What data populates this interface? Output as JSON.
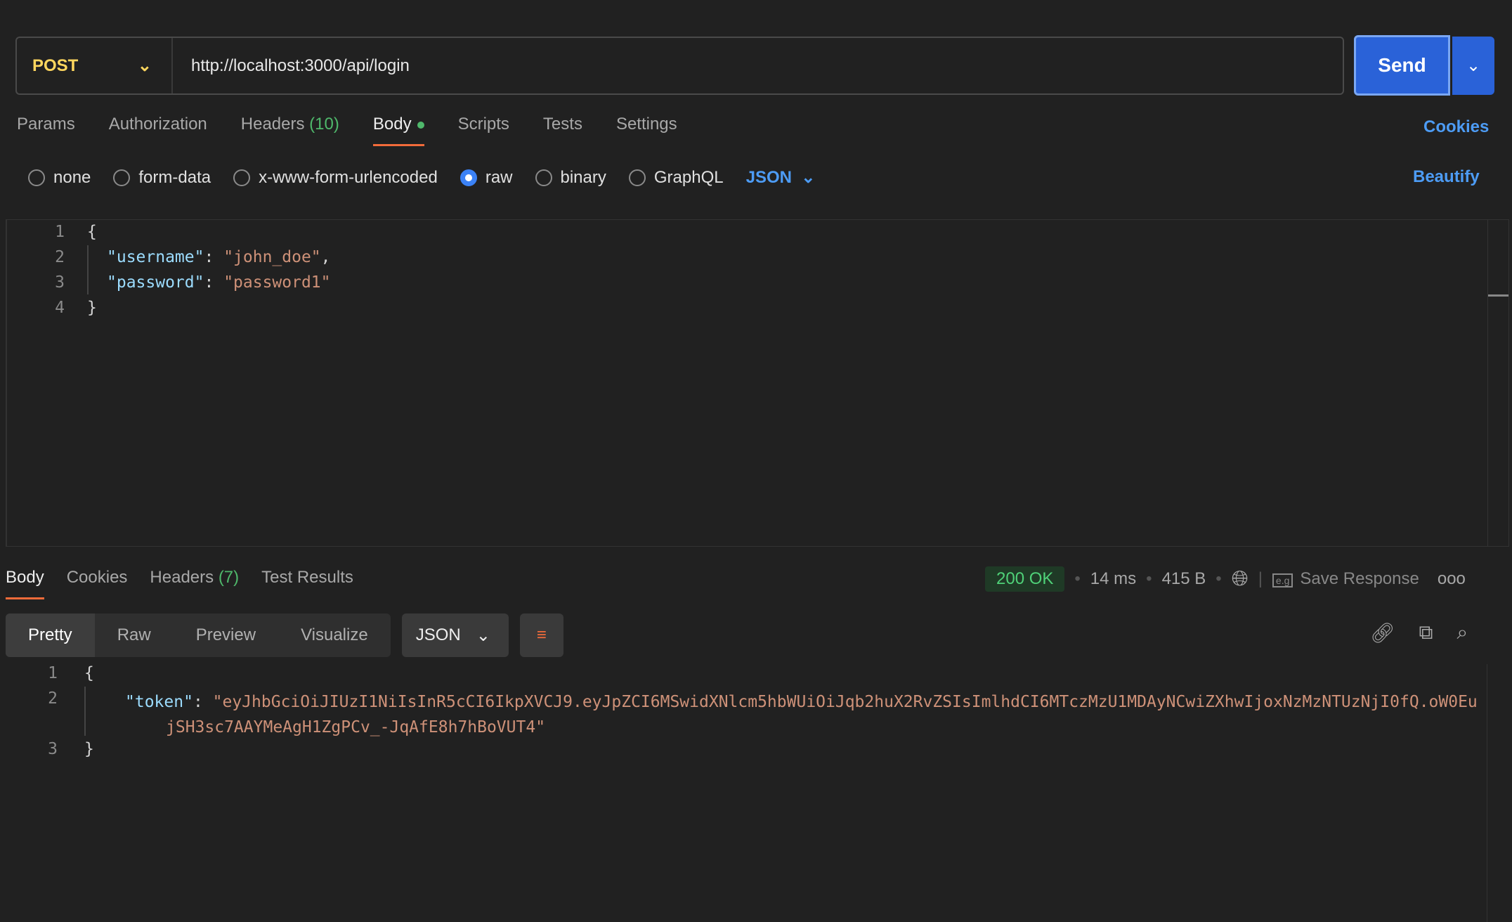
{
  "request": {
    "method": "POST",
    "url": "http://localhost:3000/api/login",
    "send_label": "Send"
  },
  "tabs": [
    {
      "label": "Params"
    },
    {
      "label": "Authorization"
    },
    {
      "label": "Headers",
      "count": "(10)"
    },
    {
      "label": "Body"
    },
    {
      "label": "Scripts"
    },
    {
      "label": "Tests"
    },
    {
      "label": "Settings"
    }
  ],
  "cookies_link": "Cookies",
  "body_types": [
    "none",
    "form-data",
    "x-www-form-urlencoded",
    "raw",
    "binary",
    "GraphQL"
  ],
  "selected_body_type": "raw",
  "body_format": "JSON",
  "beautify_label": "Beautify",
  "request_body": {
    "line_numbers": [
      "1",
      "2",
      "3",
      "4"
    ],
    "open": "{",
    "k1": "\"username\"",
    "v1": "\"john_doe\"",
    "k2": "\"password\"",
    "v2": "\"password1\"",
    "close": "}"
  },
  "response": {
    "tabs": [
      {
        "label": "Body"
      },
      {
        "label": "Cookies"
      },
      {
        "label": "Headers",
        "count": "(7)"
      },
      {
        "label": "Test Results"
      }
    ],
    "status": "200 OK",
    "time": "14 ms",
    "size": "415 B",
    "save_label": "Save Response",
    "views": [
      "Pretty",
      "Raw",
      "Preview",
      "Visualize"
    ],
    "format": "JSON",
    "line_numbers": [
      "1",
      "2",
      "3"
    ],
    "open": "{",
    "key": "\"token\"",
    "value": "\"eyJhbGciOiJIUzI1NiIsInR5cCI6IkpXVCJ9.eyJpZCI6MSwidXNlcm5hbWUiOiJqb2huX2RvZSIsImlhdCI6MTczMzU1MDAyNCwiZXhwIjoxNzMzNTUzNjI0fQ.oW0EujSH3sc7AAYMeAgH1ZgPCv_-JqAfE8h7hBoVUT4\"",
    "close": "}"
  },
  "colors": {
    "accent": "#2a62d8",
    "tab_underline": "#f26b3a",
    "method": "#ffd75e",
    "status_ok": "#4fd178"
  }
}
